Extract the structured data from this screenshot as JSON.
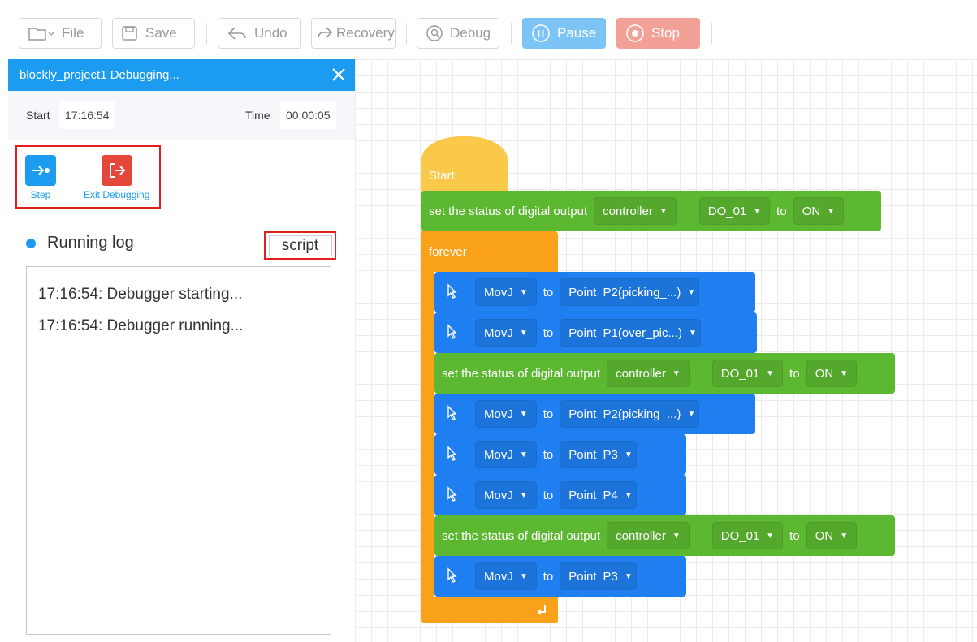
{
  "toolbar": {
    "file": "File",
    "save": "Save",
    "undo": "Undo",
    "recovery": "Recovery",
    "debug": "Debug",
    "pause": "Pause",
    "stop": "Stop"
  },
  "panel": {
    "title": "blockly_project1 Debugging...",
    "start_label": "Start",
    "start_value": "17:16:54",
    "time_label": "Time",
    "time_value": "00:00:05",
    "step_label": "Step",
    "exit_label": "Exit Debugging",
    "log_title": "Running log",
    "script_label": "script",
    "log_lines": [
      "17:16:54: Debugger starting...",
      "17:16:54: Debugger running..."
    ]
  },
  "blocks": {
    "start": "Start",
    "forever": "forever",
    "do_text": "set the status of digital output",
    "to": "to",
    "controller": "controller",
    "do_port": "DO_01",
    "on": "ON",
    "movj": "MovJ",
    "point": "Point",
    "p2": "P2(picking_...)",
    "p1": "P1(over_pic...)",
    "p3": "P3",
    "p4": "P4"
  },
  "colors": {
    "accent": "#1c9cf0",
    "highlight": "#e41f1f",
    "block_green": "#5cb831",
    "block_blue": "#1f7ff0",
    "block_orange": "#f9a11b",
    "block_yellow": "#fbc94a"
  },
  "icons": [
    "folder-icon",
    "save-icon",
    "undo-icon",
    "recovery-icon",
    "debug-icon",
    "pause-icon",
    "stop-icon",
    "close-icon",
    "step-icon",
    "exit-icon",
    "cursor-icon",
    "loop-arrow-icon"
  ]
}
